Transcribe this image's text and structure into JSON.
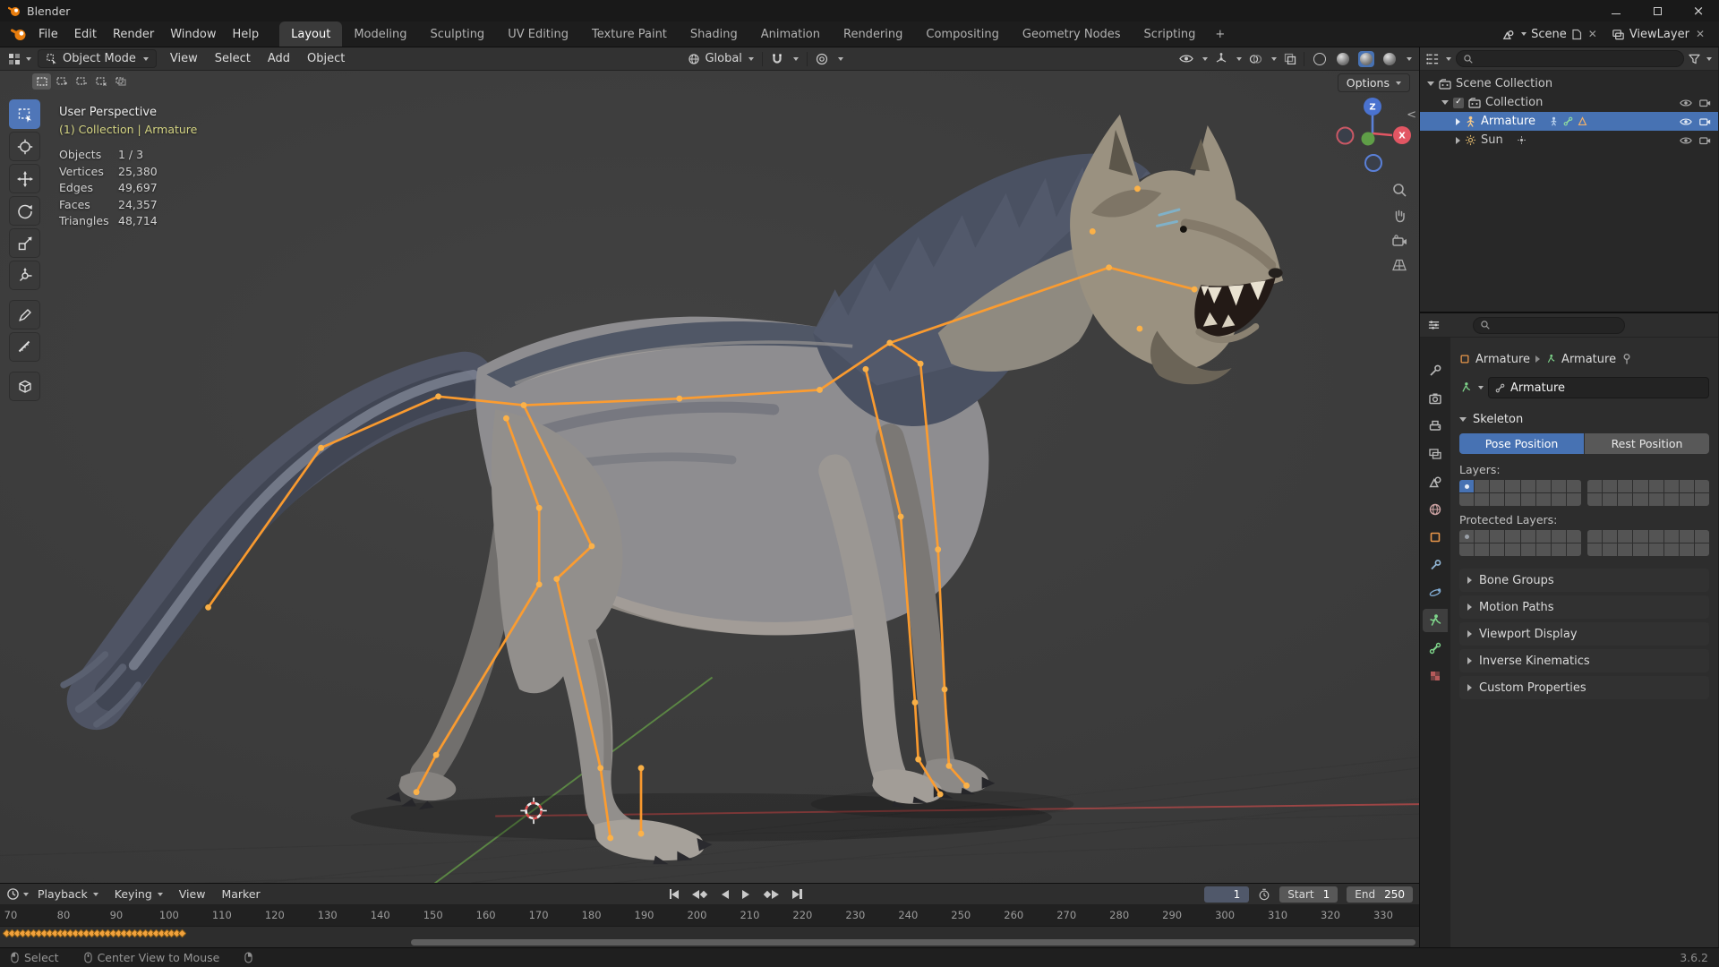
{
  "window": {
    "title": "Blender"
  },
  "menubar": {
    "menus": [
      "File",
      "Edit",
      "Render",
      "Window",
      "Help"
    ],
    "workspaces": [
      "Layout",
      "Modeling",
      "Sculpting",
      "UV Editing",
      "Texture Paint",
      "Shading",
      "Animation",
      "Rendering",
      "Compositing",
      "Geometry Nodes",
      "Scripting"
    ],
    "active_workspace": "Layout",
    "new_workspace_label": "+",
    "scene_selector": {
      "label": "Scene"
    },
    "view_layer_selector": {
      "label": "ViewLayer"
    }
  },
  "viewport_header": {
    "mode": "Object Mode",
    "menus": [
      "View",
      "Select",
      "Add",
      "Object"
    ],
    "orientation": "Global",
    "options_label": "Options"
  },
  "viewport": {
    "view_label": "User Perspective",
    "context_label": "(1) Collection | Armature",
    "stats": [
      {
        "label": "Objects",
        "value": "1 / 3"
      },
      {
        "label": "Vertices",
        "value": "25,380"
      },
      {
        "label": "Edges",
        "value": "49,697"
      },
      {
        "label": "Faces",
        "value": "24,357"
      },
      {
        "label": "Triangles",
        "value": "48,714"
      }
    ],
    "gizmo_axes": {
      "z": "Z",
      "x": "X"
    },
    "accent_orange": "#ff9d2e",
    "axis_red": "#a04646",
    "axis_green": "#5d8a45"
  },
  "outliner": {
    "rows": [
      {
        "label": "Scene Collection",
        "level": 0,
        "selected": false
      },
      {
        "label": "Collection",
        "level": 1,
        "selected": false
      },
      {
        "label": "Armature",
        "level": 2,
        "selected": true
      },
      {
        "label": "Sun",
        "level": 2,
        "selected": false
      }
    ]
  },
  "properties": {
    "breadcrumb": {
      "object": "Armature",
      "data": "Armature"
    },
    "name_value": "Armature",
    "skeleton": {
      "title": "Skeleton",
      "pose_button": "Pose Position",
      "rest_button": "Rest Position",
      "layers_label": "Layers:",
      "protected_layers_label": "Protected Layers:"
    },
    "collapsed_panels": [
      "Bone Groups",
      "Motion Paths",
      "Viewport Display",
      "Inverse Kinematics",
      "Custom Properties"
    ],
    "accent_blue": "#4772b3"
  },
  "timeline": {
    "menus": [
      "Playback",
      "Keying",
      "View",
      "Marker"
    ],
    "current_frame": "1",
    "start_label": "Start",
    "start_value": "1",
    "end_label": "End",
    "end_value": "250",
    "ruler_ticks": [
      "70",
      "80",
      "90",
      "100",
      "110",
      "120",
      "130",
      "140",
      "150",
      "160",
      "170",
      "180",
      "190",
      "200",
      "210",
      "220",
      "230",
      "240",
      "250",
      "260",
      "270",
      "280",
      "290",
      "300",
      "310",
      "320",
      "330"
    ],
    "keyframes_visible": 34
  },
  "statusbar": {
    "items": [
      "Select",
      "Center View to Mouse"
    ],
    "version": "3.6.2"
  }
}
